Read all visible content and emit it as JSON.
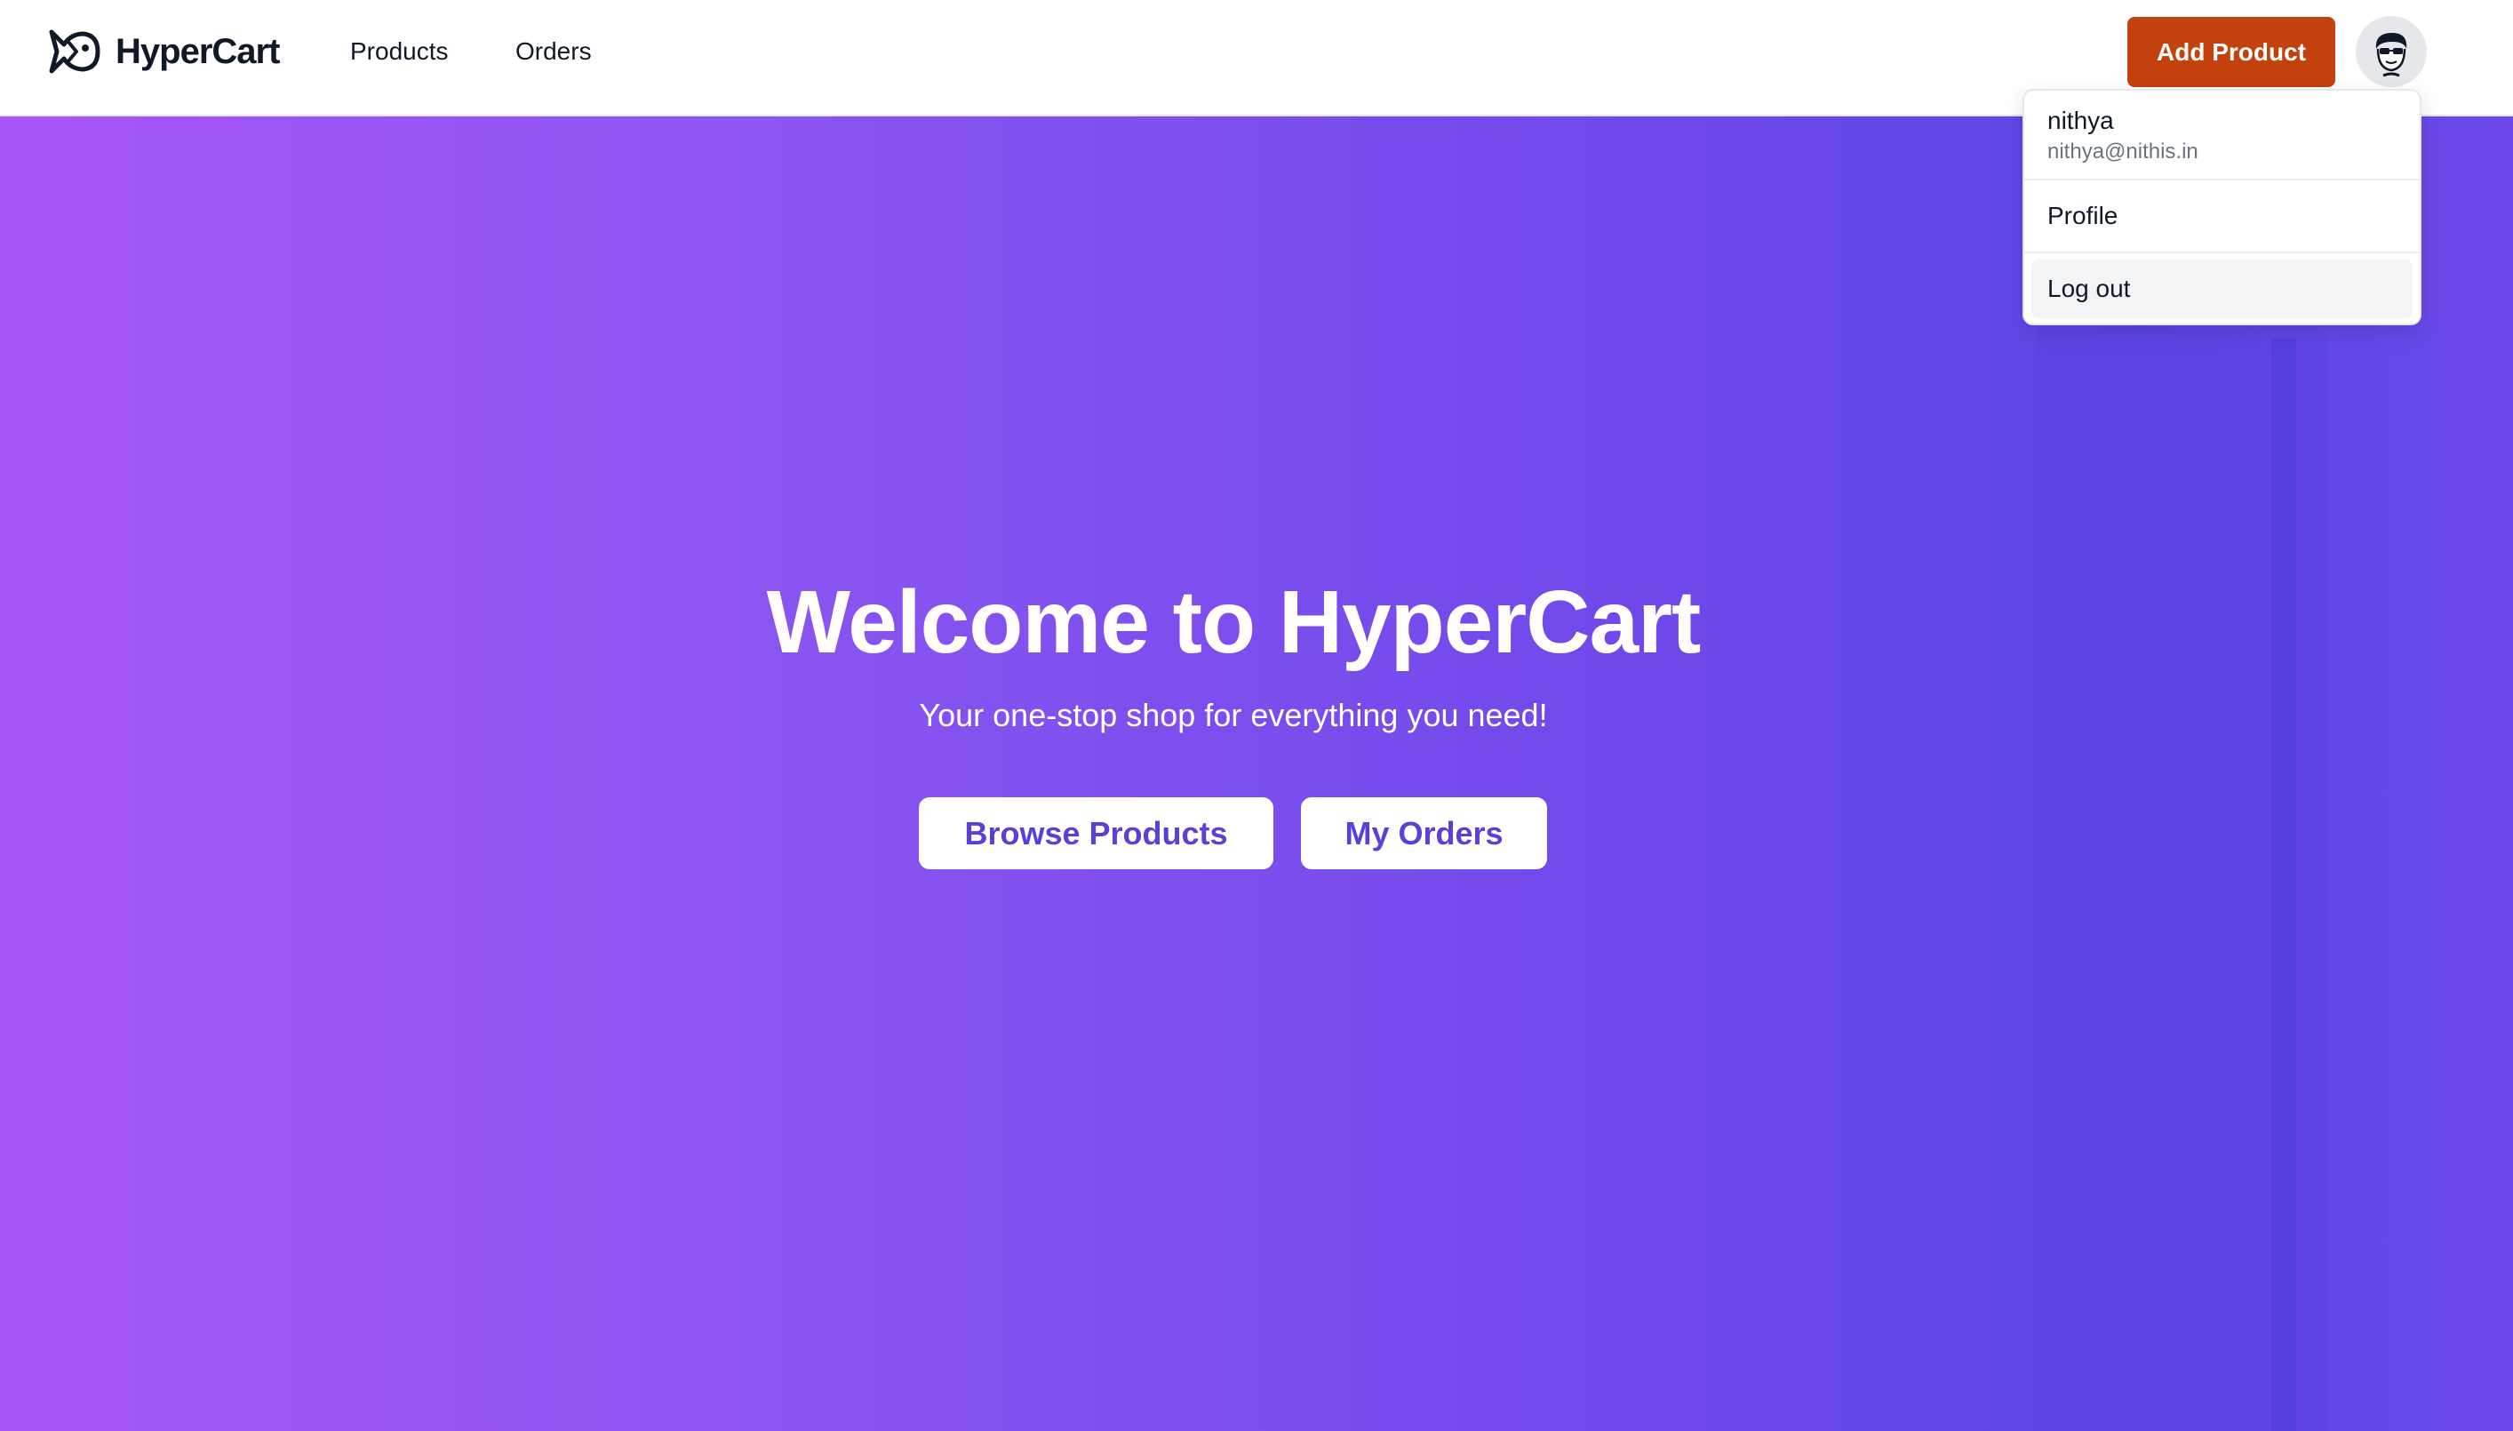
{
  "navbar": {
    "brand_name": "HyperCart",
    "brand_icon": "fish-logo-icon",
    "links": [
      {
        "label": "Products"
      },
      {
        "label": "Orders"
      }
    ],
    "add_product_label": "Add Product",
    "avatar_icon": "user-avatar-icon"
  },
  "user_menu": {
    "name": "nithya",
    "email": "nithya@nithis.in",
    "items": [
      {
        "label": "Profile"
      },
      {
        "label": "Log out"
      }
    ]
  },
  "hero": {
    "title": "Welcome to HyperCart",
    "subtitle": "Your one-stop shop for everything you need!",
    "buttons": [
      {
        "label": "Browse Products"
      },
      {
        "label": "My Orders"
      }
    ]
  },
  "colors": {
    "accent_button": "#c2410c",
    "hero_gradient_start": "#a855f7",
    "hero_gradient_end": "#6366f1",
    "hero_button_text": "#5b3fd6"
  }
}
